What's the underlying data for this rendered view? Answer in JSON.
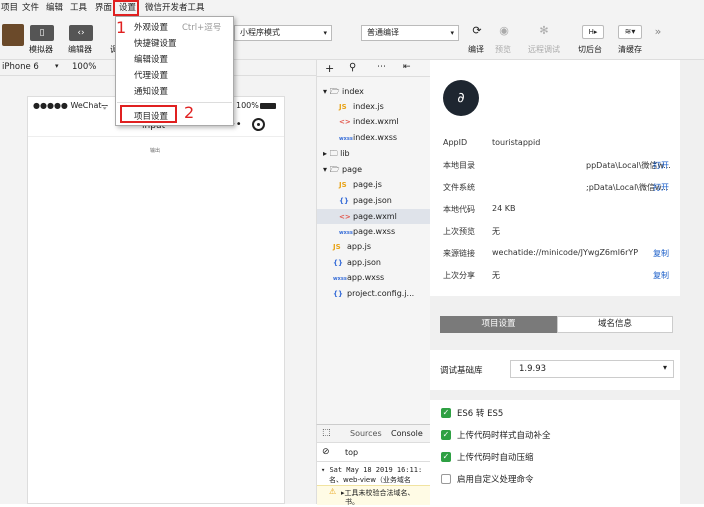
{
  "menubar": {
    "items": [
      "项目",
      "文件",
      "编辑",
      "工具",
      "界面",
      "设置",
      "微信开发者工具"
    ]
  },
  "toolbar": {
    "simulator": "模拟器",
    "editor": "编辑器",
    "debugger_partial": "调",
    "mode": "小程序模式",
    "compile_mode": "普通编译",
    "compile": "编译",
    "preview": "预览",
    "remote_debug": "远程调试",
    "background": "切后台",
    "clear_cache": "清缓存"
  },
  "device": {
    "model": "iPhone 6",
    "zoom": "100%"
  },
  "phone": {
    "carrier": "●●●●● WeChat",
    "battery": "100%",
    "title": "input",
    "body_text": "输出"
  },
  "settings_menu": {
    "items": [
      {
        "label": "外观设置",
        "shortcut": "Ctrl+逗号"
      },
      {
        "label": "快捷键设置"
      },
      {
        "label": "编辑设置"
      },
      {
        "label": "代理设置"
      },
      {
        "label": "通知设置"
      },
      {
        "label": "项目设置"
      }
    ]
  },
  "annotations": {
    "step1": "1",
    "step2": "2"
  },
  "files": {
    "index_folder": "index",
    "index_js": "index.js",
    "index_wxml": "index.wxml",
    "index_wxss": "index.wxss",
    "lib_folder": "lib",
    "page_folder": "page",
    "page_js": "page.js",
    "page_json": "page.json",
    "page_wxml": "page.wxml",
    "page_wxss": "page.wxss",
    "app_js": "app.js",
    "app_json": "app.json",
    "app_wxss": "app.wxss",
    "project_config": "project.config.j..."
  },
  "console": {
    "tabs": [
      "Sources",
      "Console"
    ],
    "filter": "top",
    "log_time": "Sat May 18 2019 16:11:",
    "log_line2": "名、web-view（业务域名",
    "warning": "工具未校验合法域名、",
    "warning2": "书。"
  },
  "info": {
    "appid_label": "AppID",
    "appid_value": "touristappid",
    "local_dir_label": "本地目录",
    "local_dir_value": "ppData\\Local\\微信w...",
    "open1": "打开",
    "file_sys_label": "文件系统",
    "file_sys_value": ";pData\\Local\\微信w...",
    "open2": "打开",
    "code_label": "本地代码",
    "code_value": "24 KB",
    "preview_label": "上次预览",
    "preview_value": "无",
    "link_label": "来源链接",
    "link_value": "wechatide://minicode/JYwgZ6ml6rYP",
    "copy1": "复制",
    "share_label": "上次分享",
    "share_value": "无",
    "copy2": "复制"
  },
  "settings_panel": {
    "tab_active": "项目设置",
    "tab_other": "域名信息",
    "lib_label": "调试基础库",
    "lib_version": "1.9.93",
    "options": [
      {
        "label": "ES6 转 ES5",
        "checked": true
      },
      {
        "label": "上传代码时样式自动补全",
        "checked": true
      },
      {
        "label": "上传代码时自动压缩",
        "checked": true
      },
      {
        "label": "启用自定义处理命令",
        "checked": false
      }
    ]
  },
  "colors": {
    "accent_red": "#e02020",
    "check_green": "#2ea043",
    "link_blue": "#1a5ec9"
  }
}
